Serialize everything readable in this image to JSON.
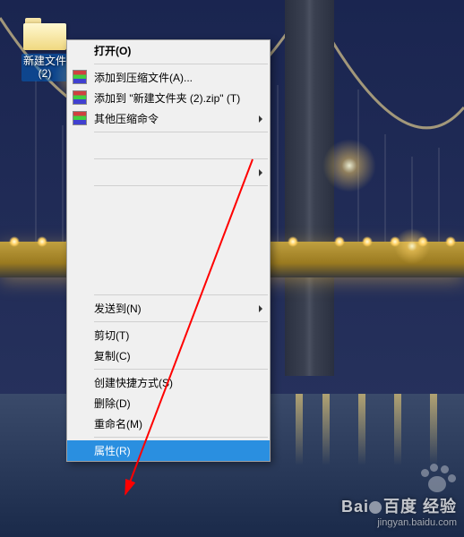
{
  "folder": {
    "label_line1": "新建文件",
    "label_line2": "(2)"
  },
  "menu": {
    "open": "打开(O)",
    "add_archive": "添加到压缩文件(A)...",
    "add_named_zip": "添加到 \"新建文件夹 (2).zip\" (T)",
    "other_compress": "其他压缩命令",
    "send_to": "发送到(N)",
    "cut": "剪切(T)",
    "copy": "复制(C)",
    "create_shortcut": "创建快捷方式(S)",
    "delete": "删除(D)",
    "rename": "重命名(M)",
    "properties": "属性(R)"
  },
  "watermark": {
    "brand": "Bai",
    "brand2": "百度",
    "sub": "经验",
    "url": "jingyan.baidu.com"
  }
}
